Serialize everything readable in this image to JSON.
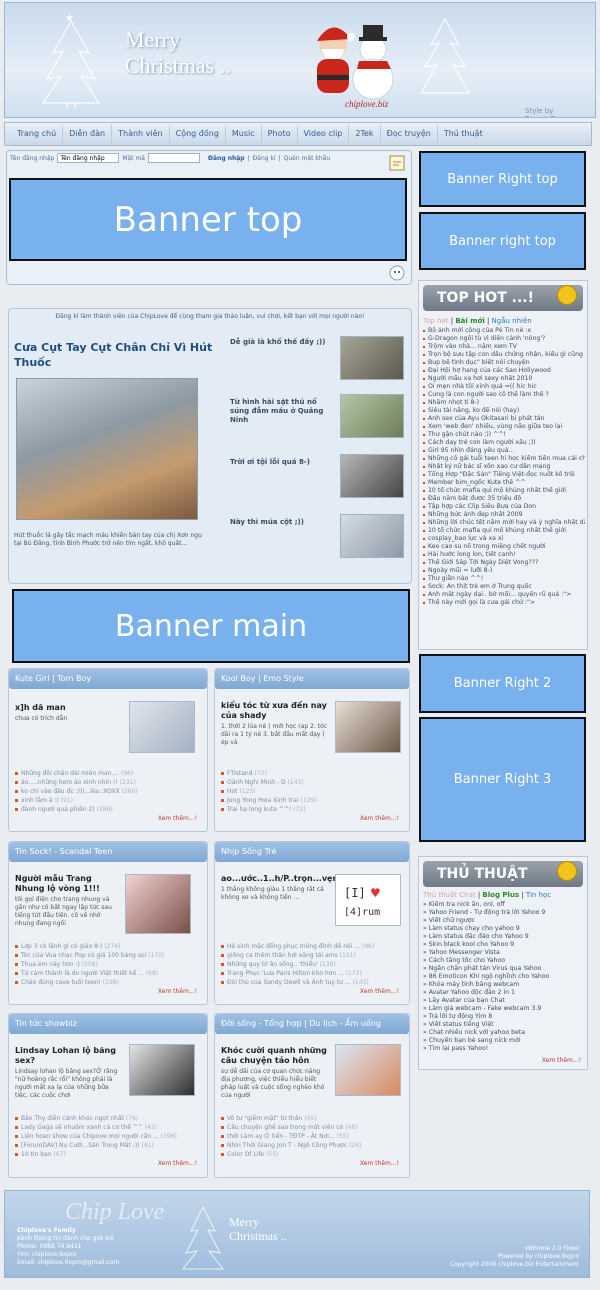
{
  "header": {
    "title": "Merry\nChristmas ..",
    "site": "chiplove.biz",
    "credit": "Style by TrangInTrang"
  },
  "nav": [
    "Trang chủ",
    "Diễn đàn",
    "Thành viên",
    "Cộng đồng",
    "Music",
    "Photo",
    "Video clip",
    "2Tek",
    "Đọc truyện",
    "Thủ thuật"
  ],
  "login": {
    "username_label": "Tên đăng nhập",
    "username_value": "Tên đăng nhập",
    "password_label": "Mật mã",
    "login_button": "Đăng nhập",
    "register_link": "Đăng kí",
    "forgot_link": "Quên mật khẩu"
  },
  "banners": {
    "top": "Banner top",
    "right_top": "Banner Right top",
    "right_top_2": "Banner right top",
    "main": "Banner main",
    "right_2": "Banner Right 2",
    "right_3": "Banner Right 3"
  },
  "featured": {
    "intro": "Đăng kí làm thành viên của ChipLove để cùng tham gia thảo luận, vui chơi, kết bạn với mọi người nào!",
    "title": "Cưa Cụt Tay Cụt Chân Chỉ Vì Hút Thuốc",
    "desc": "Hút thuốc lá gây tắc mạch máu khiến bàn tay của chị Xơn ngụ tại Bù Đăng, tỉnh Bình Phước trở nên tím ngắt, khô quắt...",
    "side_items": [
      {
        "title": "Dễ già là khổ thế đấy ;))"
      },
      {
        "title": "Từ hình hài sặt thủ nổ súng đẫm máu ở Quảng Ninh"
      },
      {
        "title": "Trời ơi tội lỗi quá 8-)"
      },
      {
        "title": "Này thì múa cột ;))"
      }
    ]
  },
  "boxes": {
    "kute": {
      "tabs": [
        "Kute Girl",
        "Tom Boy"
      ],
      "title": "x]h dã man",
      "sub": "chưa có trích dẫn",
      "items": [
        {
          "text": "Những đôi chân dài miên man....",
          "count": "(96)"
        },
        {
          "text": "ảo.....những hem ảo xinh nhìn !!",
          "count": "(231)"
        },
        {
          "text": "ko chỉ vào đâu đc :)))...lêu :XOXX",
          "count": "(260)"
        },
        {
          "text": "xinh lắm à :)",
          "count": "(91)"
        },
        {
          "text": "đánh ngươi quá phiên 2)",
          "count": "(186)"
        }
      ],
      "more": "Xem thêm...!"
    },
    "kool": {
      "tabs": [
        "Kool Boy",
        "Emo Style"
      ],
      "title": "kiểu tóc từ xưa đến nay của shady",
      "sub": "1. thời 2 lúa nè ( mới học rap 2. tóc dài ra 1 tý nè 3. bắt đầu mất dạy ( ép và",
      "items": [
        {
          "text": "FTIstand",
          "count": "(72)"
        },
        {
          "text": "Oánh Nghi Minh - D",
          "count": "(143)"
        },
        {
          "text": "Hot",
          "count": "(125)"
        },
        {
          "text": "Jung Yong Hwa Xinh trai",
          "count": "(129)"
        },
        {
          "text": "Trai hạ long kute ^^!",
          "count": "(72)"
        }
      ],
      "more": "Xem thêm...!"
    },
    "tin_sock": {
      "tabs": [
        "Tin Sock! - Scandal Teen"
      ],
      "title": "Người mẫu Trang Nhung lộ vòng 1!!!",
      "sub": "tôi gọi điện cho trang nhung và gần như cô bất ngay lập tức sau tiếng tút đầu tiên. cô về nhớ nhung đang ngồi",
      "items": [
        {
          "text": "Lớp 3 có lãnh gì có giáo 8:)",
          "count": "(274)"
        },
        {
          "text": "Tóc của Vua nhạc Pop có giá 100 bảng soi",
          "count": "(170)"
        },
        {
          "text": "Thua em này hơn :)",
          "count": "(558)"
        },
        {
          "text": "Từ cảm thành là do người Việt thiết kế ...",
          "count": "(68)"
        },
        {
          "text": "Chào đúng cave tuổi teen!",
          "count": "(198)"
        }
      ],
      "more": "Xem thêm...!"
    },
    "nhip_song": {
      "tabs": [
        "Nhịp Sống Trẻ"
      ],
      "title": "ao...ước..1..h/P..trọn...vẹn.",
      "sub": "1 thằng không giàu 1 thằng rất cá không xe và không tiền ...",
      "items": [
        {
          "text": "Hệ sinh mặc đồng phục mông đình dễ nói ...",
          "count": "(96)"
        },
        {
          "text": "giông ca thêm thân hơi xăng tái ams",
          "count": "(151)"
        },
        {
          "text": "Những quy tờ ăn sống.. 'thiếu'",
          "count": "(139)"
        },
        {
          "text": "Trang Phục 'Lưa Paris Hilton khó hơn ...",
          "count": "(172)"
        },
        {
          "text": "Đôi thù của Sandy Dewll và Ảnh tuy tư ...",
          "count": "(143)"
        }
      ],
      "more": "Xem thêm...!"
    },
    "showbiz": {
      "tabs": [
        "Tin tức showbiz"
      ],
      "title": "Lindsay Lohan lộ băng sex?",
      "sub": "Lindsay lohan lộ băng sex?Ở răng \"nữ hoàng rắc rối\" không phải là người mắt xa lạ của những bữa tiệc, các cuộc chơi",
      "items": [
        {
          "text": "Bão Thy diễn cảnh khóc ngọt nhất",
          "count": "(76)"
        },
        {
          "text": "Lady Gaga sẽ nhuộm xanh cả cơ thể ^^",
          "count": "(42)"
        },
        {
          "text": "Liên hoan show của Chipove mọi người cần ...",
          "count": "(196)"
        },
        {
          "text": "[ForumDAV] Nụ Cười...Sân Trong Mắt :))",
          "count": "(41)"
        },
        {
          "text": "10 tin bạn",
          "count": "(67)"
        }
      ],
      "more": "Xem thêm...!"
    },
    "doi_song": {
      "tabs": [
        "Đời sống - Tổng hợp",
        "Du lịch - Ẩm uống"
      ],
      "title": "Khóc cười quanh những câu chuyện tảo hôn",
      "sub": "sự dễ dãi của cơ quan chức năng địa phương, việc thiếu hiểu biết pháp luật và cuộc sống nghèo khó của người",
      "items": [
        {
          "text": "Vô tư \"giếm mặt\" từ thân",
          "count": "(45)"
        },
        {
          "text": "Câu chuyện ghế sao trong một viên có",
          "count": "(46)"
        },
        {
          "text": "thời Làm ay Ở tiến - TĐTP - Ất Nơi...",
          "count": "(55)"
        },
        {
          "text": "Nhìn Thời Giang Jon T - Ngô Công Phược",
          "count": "(26)"
        },
        {
          "text": "Color Of Life",
          "count": "(55)"
        }
      ],
      "more": "Xem thêm...!"
    }
  },
  "top_hot": {
    "heading": "TOP HOT ...!",
    "tabs": [
      "Top hot",
      "Bài mới",
      "Ngẫu nhiên"
    ],
    "items": [
      "Bộ ảnh mới công của Pé Tin nè :x",
      "G-Dragon ngồi tù vì diễn cảnh 'nóng'?",
      "Trộm vào nhà... nằm xem TV",
      "Trọn bộ sưu tập con dâu chứng nhận, kiểu gì cũng có =]]",
      "Bup bê tình dục\" biết nói chuyện",
      "Đại Hội hợ hang của các Sao Hollywood",
      "Người mẫu xa hơi sexy nhất 2010",
      "Ôi mẹn nhà tôi xinh quá =((  hic hic",
      "Cung là con người sao cô thể làm thế ?",
      "Nhăm nhọt tí 8-)",
      "Siêu tài năng, ko để nói (hay)",
      "Ảnh sex của Ayu Okitasari bị phát tán",
      "Xem 'web đen' nhiều, vùng não giữa teo lại",
      "Thư gặn chút nào ;)) ^^!",
      "Cách dạy trẻ con làm người xấu ;))",
      "Girl 95 nhìn đáng yêu quá...",
      "Những cô gái tuổi teen hi học kiếm tiền mua cái chết",
      "Nhật ký nữ bác sĩ xôn xao cư dân mạng",
      "Tổng Hợp \"Đặc Sản\" Tiếng Việt-đọc nuốt kô trôi",
      "Member bịm_ngốc Kute thế ^^",
      "10 tổ chức mafia quỉ mộ khủng nhất thế giới",
      "Đầu năm bắt được 35 triệu đô",
      "Tập hợp các Clip Siêu Bựa của Don",
      "Những bức ảnh đẹp nhất 2009",
      "Những lời chúc tết nằm mới hay và ý nghĩa nhất dành cho năm 2010",
      "10 tổ chức mafia quỉ mô khủng nhất thế giới",
      "cosplay_bao lực và xa xỉ",
      "Keo cao su nổ trong miệng chết người",
      "Hài hước long lon, tiết canh!",
      "Thế Giới Sắp Tới Ngày Diệt Vong???",
      "Ngoày mũi = lưỡi 8-)",
      "Thư giãn nào ^^!",
      "Sock: Ăn thịt trẻ em ở Trung quốc",
      "Ảnh mắt ngày dại.. bờ mõi... quyến rũ quá :\">",
      "Thế này mới gọi là cưa gái chứ :\">"
    ]
  },
  "thu_thuat": {
    "heading": "THỦ THUẬT",
    "tabs": [
      "Thủ thuật Chat",
      "Blog Plus",
      "Tin học"
    ],
    "items": [
      "Kiểm tra nick ẩn, onl, off",
      "Yahoo Friend - Tự động trả lời Yahoo 9",
      "Viết chữ ngược",
      "Làm status chạy cho yahoo 9",
      "Làm status đặc đáo cho Yahoo 9",
      "Skin black kool cho Yahoo 9",
      "Yahoo Messenger Vista",
      "Cách tăng tốc cho Yahoo",
      "Ngăn chặn phát tán Virus qua Yahoo",
      "86 Emoticon Khí ngộ nghĩnh cho Yahoo",
      "Khóa máy tính bằng webcam",
      "Avatar Yahoo độc đáo 2 in 1",
      "Lấy Avatar của bạn Chat",
      "Làm giả webcam - Fake webcam 3.9",
      "Trả lời tự động Yim 8",
      "Viết status tiếng Việt",
      "Chat nhiều nick với yahoo beta",
      "Chuyển bạn bè sang nick mới",
      "Tìm lại pass Yahoo!"
    ],
    "more": "Xem thêm...!"
  },
  "footer": {
    "script_text": "Chip Love",
    "merry": "Merry\nChristmas ..",
    "left_lines": [
      "Chiplove's Family",
      "Kênh thông tin dành cho giới trẻ",
      "Phone: 0988.74.9411",
      "Yim: chiplove.9xpro",
      "Email: chiplove.9xpro@gmail.com"
    ],
    "right_lines": [
      "vBHome 2.0 Fixed",
      "Powered by chiplove.9xpro",
      "Copyright 2009 chiplove.biz Entertainment"
    ]
  },
  "colors": {
    "banner": "#78b1ee",
    "accent": "#2f5f97",
    "box_header": "#8db3dc",
    "right_header": "#7b858f"
  }
}
